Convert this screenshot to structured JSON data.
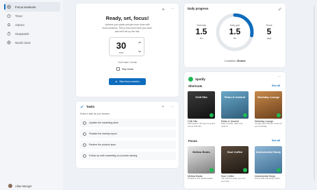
{
  "sidebar": {
    "items": [
      {
        "label": "Focus sessions",
        "icon": "focus-icon"
      },
      {
        "label": "Timer",
        "icon": "timer-icon"
      },
      {
        "label": "Alarms",
        "icon": "alarm-icon"
      },
      {
        "label": "Stopwatch",
        "icon": "stopwatch-icon"
      },
      {
        "label": "World clock",
        "icon": "globe-icon"
      }
    ],
    "user": "Allan Munger"
  },
  "focus": {
    "title": "Ready, set, focus!",
    "subtitle": "Achieve your goals and get more done with focus sessions. Tell us how much time you have, and we'll set up the rest.",
    "minutes": "30",
    "unit": "mins",
    "break_note": "You'll have 1 break",
    "skip_label": "Skip break",
    "start_label": "Start focus session"
  },
  "tasks": {
    "title": "Tasks",
    "input_placeholder": "Select a task for your session",
    "items": [
      "Update the marketing deck",
      "Finalize the weekly report",
      "Review the product spec",
      "Follow up with marketing on product naming"
    ]
  },
  "progress": {
    "title": "Daily progress",
    "yesterday": {
      "label": "Yesterday",
      "value": "1.5",
      "unit": "hrs"
    },
    "goal": {
      "label": "Daily goal",
      "value": "1.5",
      "unit": "hrs"
    },
    "streak": {
      "label": "Streak",
      "value": "5",
      "unit": "days"
    },
    "completed_label": "Completed:",
    "completed_value": "25 mins",
    "ring_fraction": 0.28
  },
  "spotify": {
    "brand": "Spotify",
    "shortcuts": {
      "title": "Shortcuts",
      "see_all": "See all",
      "tiles": [
        {
          "cover": "Chill Hits",
          "name": "Chill Hits",
          "desc": "Kick back to the best new and recent chill hits."
        },
        {
          "cover": "Relax & Unwind",
          "name": "Relax & Unwind",
          "desc": "Take a break, relax and unwind."
        },
        {
          "cover": "Workday Lounge",
          "name": "Workday Lounge",
          "desc": "Lounge and chill out music for your workday."
        }
      ]
    },
    "focus": {
      "title": "Focus",
      "see_all": "See all",
      "tiles": [
        {
          "cover": "Mellow Beats",
          "name": "Mellow Beats",
          "desc": "Unwind to the mellow beats."
        },
        {
          "cover": "Soul Coffee",
          "name": "Soul Coffee",
          "desc": "The tunes to ease you into your day."
        },
        {
          "cover": "Instrumental Study",
          "name": "Instrumental Study",
          "desc": "Focus with soft study music."
        }
      ]
    }
  },
  "colors": {
    "accent": "#0f6cbd",
    "spotify": "#1db954"
  }
}
